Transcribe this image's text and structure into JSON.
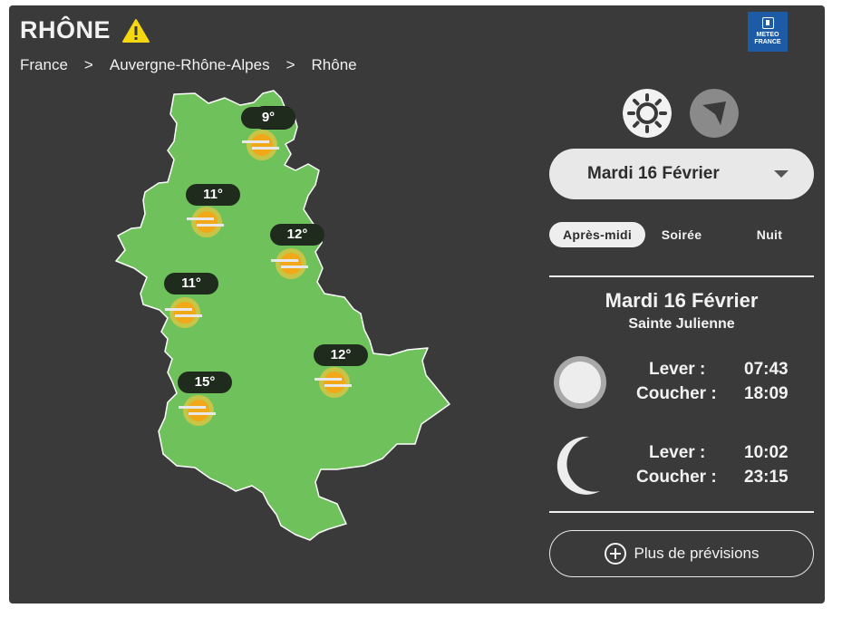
{
  "header": {
    "title": "RHÔNE",
    "alert_icon": "warning-triangle-icon",
    "alert_color": "#f5d80f",
    "logo_text": [
      "METEO",
      "FRANCE"
    ],
    "logo_color": "#1d5ba7"
  },
  "breadcrumb": [
    {
      "label": "France"
    },
    {
      "label": ">"
    },
    {
      "label": "Auvergne-Rhône-Alpes"
    },
    {
      "label": ">"
    },
    {
      "label": "Rhône"
    }
  ],
  "map": {
    "fill_color": "#6fc25b",
    "points": [
      {
        "temp": "9°",
        "weather_icon": "sun-haze-icon"
      },
      {
        "temp": "11°",
        "weather_icon": "sun-haze-icon"
      },
      {
        "temp": "12°",
        "weather_icon": "sun-haze-icon"
      },
      {
        "temp": "11°",
        "weather_icon": "sun-haze-icon"
      },
      {
        "temp": "12°",
        "weather_icon": "sun-haze-icon"
      },
      {
        "temp": "15°",
        "weather_icon": "sun-haze-icon"
      }
    ]
  },
  "controls": {
    "day_icon": "sun-icon",
    "locate_icon": "location-arrow-icon",
    "day_select": "Mardi 16 Février",
    "tabs": [
      {
        "label": "Après-midi",
        "active": true
      },
      {
        "label": "Soirée",
        "active": false
      },
      {
        "label": "Nuit",
        "active": false
      }
    ]
  },
  "ephemeris": {
    "date": "Mardi 16 Février",
    "saint": "Sainte Julienne",
    "sun": {
      "icon": "sun-disc-icon",
      "rise_label": "Lever :",
      "rise": "07:43",
      "set_label": "Coucher :",
      "set": "18:09"
    },
    "moon": {
      "icon": "crescent-moon-icon",
      "rise_label": "Lever :",
      "rise": "10:02",
      "set_label": "Coucher :",
      "set": "23:15"
    }
  },
  "more_button": {
    "label": "Plus de prévisions",
    "icon": "plus-circle-icon"
  }
}
